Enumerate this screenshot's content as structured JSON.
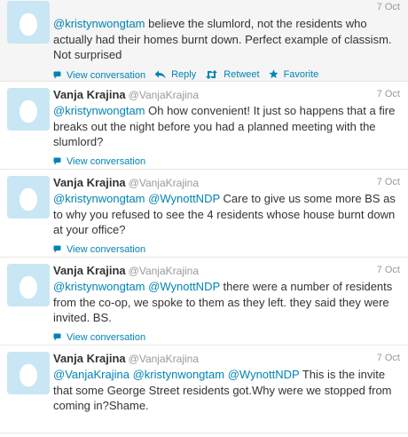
{
  "tweets": [
    {
      "name": "",
      "handle": "",
      "time": "7 Oct",
      "parts": [
        {
          "t": "@kristynwongtam",
          "m": true
        },
        {
          "t": " believe the slumlord, not the residents who actually had their homes burnt down. Perfect example of classism. Not surprised",
          "m": false
        }
      ],
      "actions": [
        {
          "label": "View conversation",
          "icon": "speech-bubble-icon"
        },
        {
          "label": "Reply",
          "icon": "reply-arrow-icon"
        },
        {
          "label": "Retweet",
          "icon": "retweet-icon"
        },
        {
          "label": "Favorite",
          "icon": "star-icon"
        }
      ]
    },
    {
      "name": "Vanja Krajina",
      "handle": "@VanjaKrajina",
      "time": "7 Oct",
      "parts": [
        {
          "t": "@kristynwongtam",
          "m": true
        },
        {
          "t": " Oh how convenient! It just so happens that a fire breaks out the night before you had a planned meeting with the slumlord?",
          "m": false
        }
      ],
      "actions": [
        {
          "label": "View conversation",
          "icon": "speech-bubble-icon"
        }
      ]
    },
    {
      "name": "Vanja Krajina",
      "handle": "@VanjaKrajina",
      "time": "7 Oct",
      "parts": [
        {
          "t": "@kristynwongtam",
          "m": true
        },
        {
          "t": " ",
          "m": false
        },
        {
          "t": "@WynottNDP",
          "m": true
        },
        {
          "t": " Care to give us some more BS as to why you refused to see the 4 residents whose house burnt down at your office?",
          "m": false
        }
      ],
      "actions": [
        {
          "label": "View conversation",
          "icon": "speech-bubble-icon"
        }
      ]
    },
    {
      "name": "Vanja Krajina",
      "handle": "@VanjaKrajina",
      "time": "7 Oct",
      "parts": [
        {
          "t": "@kristynwongtam",
          "m": true
        },
        {
          "t": " ",
          "m": false
        },
        {
          "t": "@WynottNDP",
          "m": true
        },
        {
          "t": " there were a number of residents from the co-op, we spoke to them as they left. they said they were invited. BS.",
          "m": false
        }
      ],
      "actions": [
        {
          "label": "View conversation",
          "icon": "speech-bubble-icon"
        }
      ]
    },
    {
      "name": "Vanja Krajina",
      "handle": "@VanjaKrajina",
      "time": "7 Oct",
      "parts": [
        {
          "t": "@VanjaKrajina",
          "m": true
        },
        {
          "t": " ",
          "m": false
        },
        {
          "t": "@kristynwongtam",
          "m": true
        },
        {
          "t": " ",
          "m": false
        },
        {
          "t": "@WynottNDP",
          "m": true
        },
        {
          "t": " This is the invite that some George Street residents got.Why were we stopped from coming in?Shame.",
          "m": false
        }
      ],
      "actions": []
    }
  ]
}
